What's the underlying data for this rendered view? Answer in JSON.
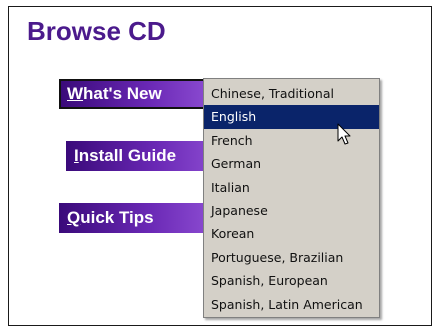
{
  "page": {
    "title": "Browse CD"
  },
  "nav": {
    "whats_new": {
      "accel": "W",
      "rest": "hat's New"
    },
    "install_guide": {
      "accel": "I",
      "rest": "nstall Guide"
    },
    "quick_tips": {
      "accel": "Q",
      "rest": "uick Tips"
    }
  },
  "language_menu": {
    "selected": "English",
    "options": [
      "Chinese, Traditional",
      "English",
      "French",
      "German",
      "Italian",
      "Japanese",
      "Korean",
      "Portuguese, Brazilian",
      "Spanish, European",
      "Spanish, Latin American"
    ]
  },
  "colors": {
    "title": "#4b1a8c",
    "button_dark": "#3a0a7a",
    "button_light": "#8a4ad0",
    "menu_bg": "#d4d0c8",
    "menu_highlight": "#0a246a"
  },
  "icons": {
    "pointer": "arrow-cursor-icon"
  }
}
